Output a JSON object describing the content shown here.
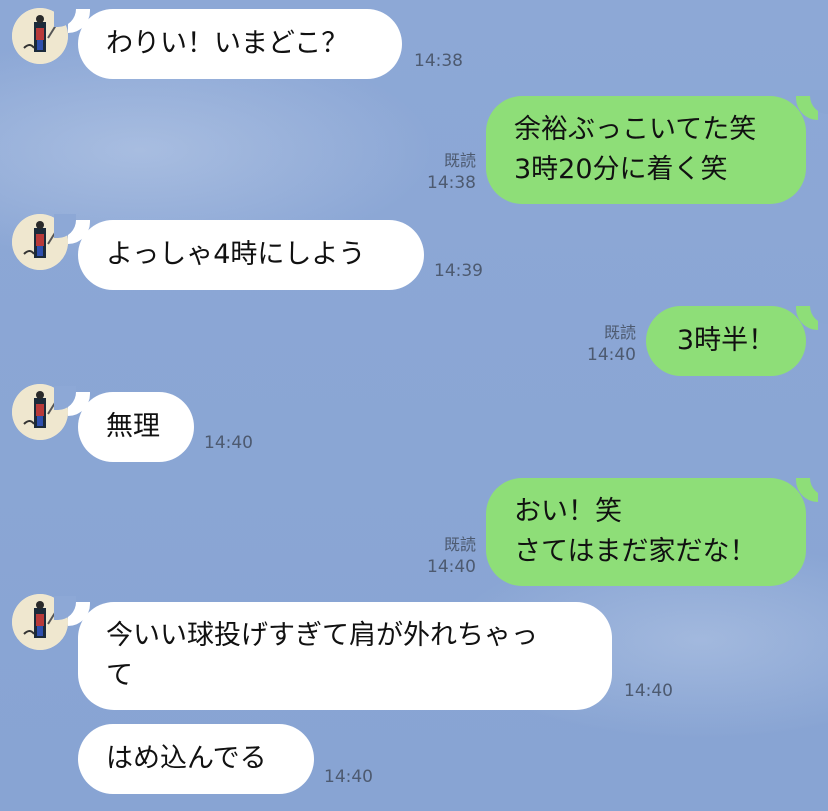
{
  "messages": [
    {
      "side": "in",
      "text": "わりい！いまどこ？",
      "time": "14:38",
      "avatar": "profile-avatar"
    },
    {
      "side": "out",
      "text": "余裕ぶっこいてた笑\n3時20分に着く笑",
      "time": "14:38",
      "read": "既読"
    },
    {
      "side": "in",
      "text": "よっしゃ4時にしよう",
      "time": "14:39",
      "avatar": "profile-avatar"
    },
    {
      "side": "out",
      "text": "3時半！",
      "time": "14:40",
      "read": "既読"
    },
    {
      "side": "in",
      "text": "無理",
      "time": "14:40",
      "avatar": "profile-avatar"
    },
    {
      "side": "out",
      "text": "おい！笑\nさてはまだ家だな！",
      "time": "14:40",
      "read": "既読"
    },
    {
      "side": "in",
      "text": "今いい球投げすぎて肩が外れちゃっ\nて",
      "time": "14:40",
      "avatar": "profile-avatar"
    },
    {
      "side": "in",
      "text": "はめ込んでる",
      "time": "14:40"
    }
  ],
  "colors": {
    "background": "#8aa6d4",
    "incoming_bubble": "#ffffff",
    "outgoing_bubble": "#8ede78",
    "meta_text": "#4d5a70"
  }
}
